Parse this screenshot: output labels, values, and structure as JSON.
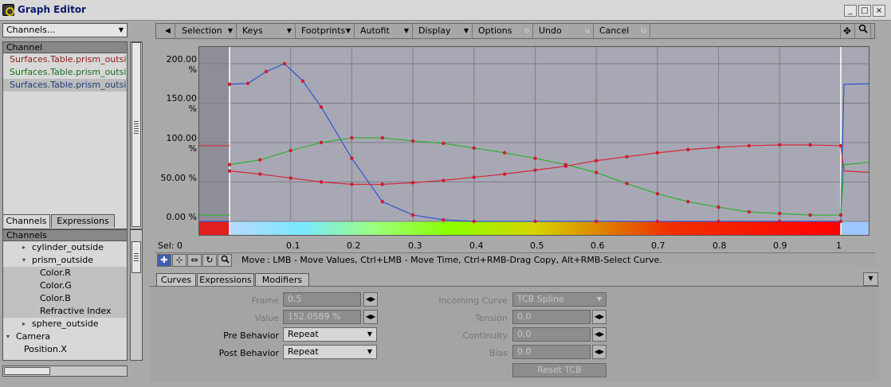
{
  "window": {
    "title": "Graph Editor",
    "min": "_",
    "max": "□",
    "close": "×"
  },
  "left": {
    "channels_dropdown": "Channels...",
    "channel_list": {
      "header": "Channel",
      "items": [
        {
          "label": "Surfaces.Table.prism_outsid ...",
          "color": "#8b1b1b"
        },
        {
          "label": "Surfaces.Table.prism_outsid ...",
          "color": "#1c6d1c"
        },
        {
          "label": "Surfaces.Table.prism_outsid ...",
          "color": "#1f3a78"
        }
      ]
    },
    "tabs": [
      "Channels",
      "Expressions"
    ],
    "tree_header": "Channels",
    "tree": [
      {
        "label": "cylinder_outside",
        "indent": 36,
        "tri": "▸"
      },
      {
        "label": "prism_outside",
        "indent": 36,
        "tri": "▾"
      },
      {
        "label": "Color.R",
        "indent": 46,
        "tri": ""
      },
      {
        "label": "Color.G",
        "indent": 46,
        "tri": ""
      },
      {
        "label": "Color.B",
        "indent": 46,
        "tri": ""
      },
      {
        "label": "Refractive Index",
        "indent": 46,
        "tri": ""
      },
      {
        "label": "sphere_outside",
        "indent": 36,
        "tri": "▸"
      },
      {
        "label": "Camera",
        "indent": 16,
        "tri": "▾"
      },
      {
        "label": "Position.X",
        "indent": 26,
        "tri": ""
      }
    ]
  },
  "toolbar": {
    "selection": "Selection",
    "keys": "Keys",
    "footprints": "Footprints",
    "autofit": "Autofit",
    "display": "Display",
    "options": "Options",
    "options_sc": "o",
    "undo": "Undo",
    "undo_sc": "u",
    "cancel": "Cancel",
    "cancel_sc": "U"
  },
  "graph": {
    "sel": "Sel: 0",
    "y_ticks": [
      "200.00 %",
      "150.00 %",
      "100.00 %",
      "50.00 %",
      "0.00 %"
    ],
    "x_ticks": [
      "0.1",
      "0.2",
      "0.3",
      "0.4",
      "0.5",
      "0.6",
      "0.7",
      "0.8",
      "0.9",
      "1"
    ]
  },
  "chart_data": {
    "type": "line",
    "xlim": [
      -0.05,
      1.05
    ],
    "ylim": [
      -30,
      215
    ],
    "x_ticks": [
      0.1,
      0.2,
      0.3,
      0.4,
      0.5,
      0.6,
      0.7,
      0.8,
      0.9,
      1.0
    ],
    "y_ticks": [
      0,
      50,
      100,
      150,
      200
    ],
    "grid": true,
    "series": [
      {
        "color": "#2f55d0",
        "x": [
          0.0,
          0.03,
          0.06,
          0.09,
          0.12,
          0.15,
          0.2,
          0.25,
          0.3,
          0.35,
          0.4,
          0.5,
          0.6,
          0.7,
          0.8,
          0.9,
          1.0
        ],
        "y": [
          174,
          175,
          190,
          200,
          178,
          145,
          80,
          25,
          8,
          2,
          0,
          0,
          0,
          0,
          0,
          0,
          0
        ]
      },
      {
        "color": "#2fae2f",
        "x": [
          0.0,
          0.05,
          0.1,
          0.15,
          0.2,
          0.25,
          0.3,
          0.35,
          0.4,
          0.45,
          0.5,
          0.55,
          0.6,
          0.65,
          0.7,
          0.75,
          0.8,
          0.85,
          0.9,
          0.95,
          1.0
        ],
        "y": [
          72,
          78,
          90,
          100,
          106,
          106,
          102,
          99,
          93,
          87,
          80,
          72,
          62,
          48,
          35,
          25,
          18,
          12,
          10,
          8,
          8
        ]
      },
      {
        "color": "#d02a3a",
        "x": [
          0.0,
          0.05,
          0.1,
          0.15,
          0.2,
          0.25,
          0.3,
          0.35,
          0.4,
          0.45,
          0.5,
          0.55,
          0.6,
          0.65,
          0.7,
          0.75,
          0.8,
          0.85,
          0.9,
          0.95,
          1.0
        ],
        "y": [
          64,
          60,
          55,
          50,
          47,
          47,
          49,
          52,
          56,
          60,
          65,
          70,
          77,
          82,
          87,
          91,
          94,
          96,
          97,
          97,
          96
        ]
      }
    ]
  },
  "status": {
    "mode": "Move",
    "hint": ":  LMB - Move Values, Ctrl+LMB - Move Time, Ctrl+RMB-Drag Copy, Alt+RMB-Select Curve."
  },
  "bottom_tabs": [
    "Curves",
    "Expressions",
    "Modifiers"
  ],
  "props": {
    "frame": {
      "label": "Frame",
      "value": "0.5"
    },
    "value": {
      "label": "Value",
      "value": "152.0589 %"
    },
    "pre": {
      "label": "Pre Behavior",
      "value": "Repeat"
    },
    "post": {
      "label": "Post Behavior",
      "value": "Repeat"
    },
    "incoming": {
      "label": "Incoming Curve",
      "value": "TCB Spline"
    },
    "tension": {
      "label": "Tension",
      "value": "0.0"
    },
    "continuity": {
      "label": "Continuity",
      "value": "0.0"
    },
    "bias": {
      "label": "Bias",
      "value": "0.0"
    },
    "reset": "Reset TCB"
  }
}
